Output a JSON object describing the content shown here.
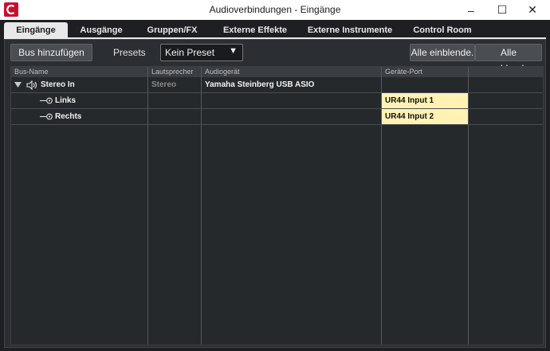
{
  "window": {
    "title": "Audioverbindungen - Eingänge",
    "controls": {
      "minimize": "–",
      "maximize": "☐",
      "close": "✕"
    },
    "app_icon": "cubase-logo-icon",
    "accent": "#c8102e"
  },
  "tabs": [
    {
      "label": "Eingänge",
      "active": true
    },
    {
      "label": "Ausgänge",
      "active": false
    },
    {
      "label": "Gruppen/FX",
      "active": false
    },
    {
      "label": "Externe Effekte",
      "active": false
    },
    {
      "label": "Externe Instrumente",
      "active": false
    },
    {
      "label": "Control Room",
      "active": false
    }
  ],
  "toolbar": {
    "add_bus": "Bus hinzufügen",
    "presets_label": "Presets",
    "preset_value": "Kein Preset",
    "show_all": "Alle einblende.",
    "hide_all": "Alle ausblende."
  },
  "table": {
    "columns": [
      "Bus-Name",
      "Lautsprecher",
      "Audiogerät",
      "Geräte-Port",
      ""
    ],
    "rows": [
      {
        "bus_name": "Stereo In",
        "speaker": "Stereo",
        "device": "Yamaha Steinberg USB ASIO",
        "port": "",
        "expanded": true,
        "icon": "speaker-icon"
      },
      {
        "bus_name": "Links",
        "speaker": "",
        "device": "",
        "port": "UR44 Input 1",
        "icon": "input-connector-icon"
      },
      {
        "bus_name": "Rechts",
        "speaker": "",
        "device": "",
        "port": "UR44 Input 2",
        "icon": "input-connector-icon"
      }
    ],
    "port_highlight_color": "#fff2b3"
  }
}
